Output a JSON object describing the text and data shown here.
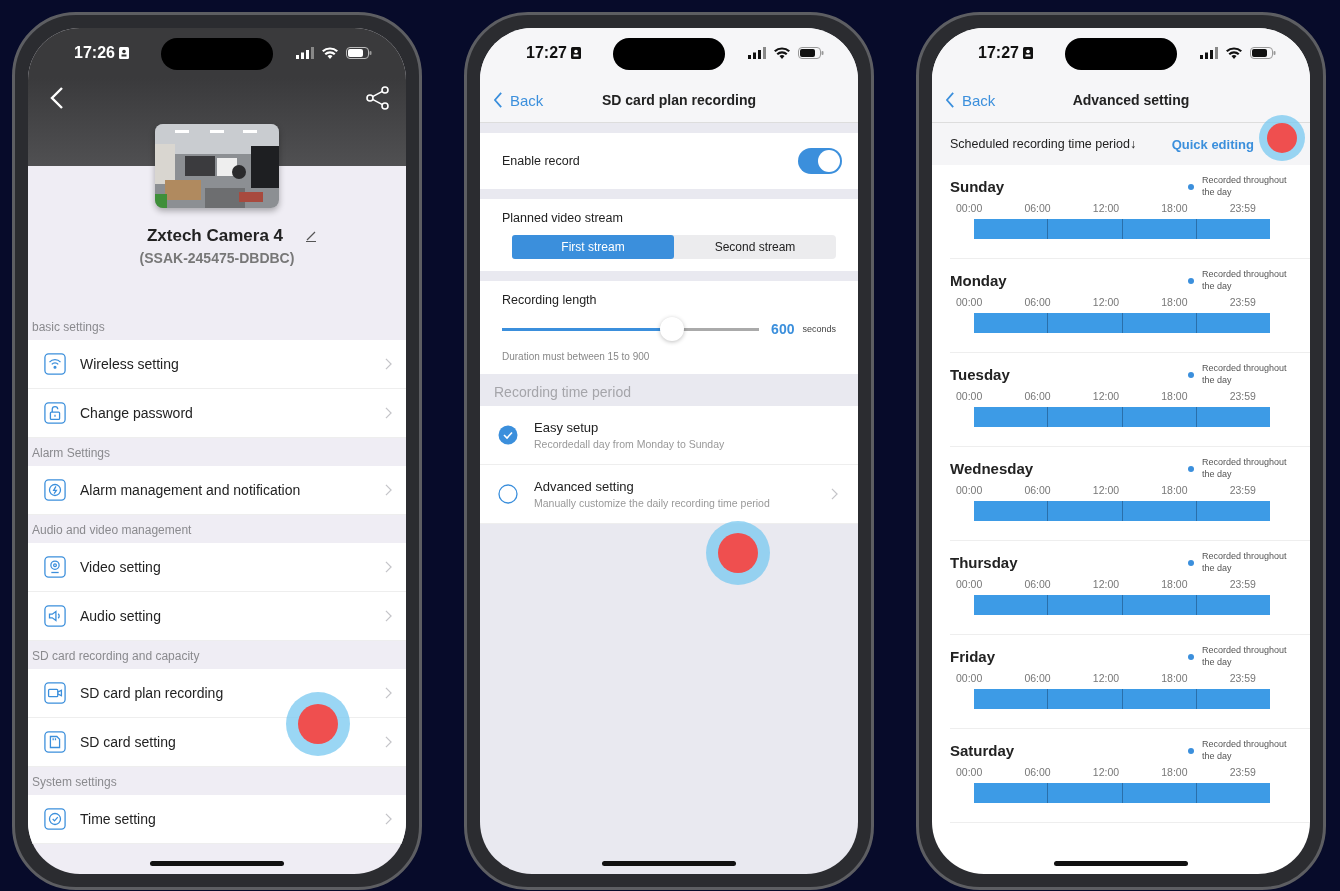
{
  "device_screen": {
    "status_time": "17:26",
    "device_name": "Zxtech Camera 4",
    "device_id": "(SSAK-245475-DBDBC)",
    "sections": [
      {
        "title": "basic settings",
        "items": [
          {
            "label": "Wireless setting",
            "kind": "wifi"
          },
          {
            "label": "Change password",
            "kind": "lock"
          }
        ]
      },
      {
        "title": "Alarm Settings",
        "items": [
          {
            "label": "Alarm management and notification",
            "kind": "alarm"
          }
        ]
      },
      {
        "title": "Audio and video management",
        "items": [
          {
            "label": "Video setting",
            "kind": "webcam"
          },
          {
            "label": "Audio setting",
            "kind": "speaker"
          }
        ]
      },
      {
        "title": "SD card recording and capacity",
        "items": [
          {
            "label": "SD card plan recording",
            "kind": "video"
          },
          {
            "label": "SD card setting",
            "kind": "sdcard"
          }
        ]
      },
      {
        "title": "System settings",
        "items": [
          {
            "label": "Time setting",
            "kind": "clock"
          }
        ]
      }
    ]
  },
  "plan_screen": {
    "status_time": "17:27",
    "back": "Back",
    "title": "SD card plan recording",
    "enable": {
      "label": "Enable record",
      "on": true
    },
    "stream": {
      "label": "Planned video stream",
      "options": [
        {
          "label": "First stream",
          "selected": true
        },
        {
          "label": "Second stream",
          "selected": false
        }
      ]
    },
    "length": {
      "label": "Recording length",
      "level": 0.66,
      "value": "600",
      "unit": "seconds",
      "hint": "Duration must between 15 to 900"
    },
    "period": {
      "title": "Recording time period",
      "options": [
        {
          "label": "Easy setup",
          "description": "Recordedall day from Monday to Sunday",
          "selected": true,
          "has_detail": false
        },
        {
          "label": "Advanced setting",
          "description": "Manually customize the daily recording time period",
          "selected": false,
          "has_detail": true
        }
      ]
    }
  },
  "advanced_screen": {
    "status_time": "17:27",
    "back": "Back",
    "title": "Advanced setting",
    "header": "Scheduled recording time period↓",
    "action": "Quick editing",
    "days": [
      {
        "name": "Sunday",
        "legend": "Recorded throughout the day",
        "ticks": [
          "00:00",
          "06:00",
          "12:00",
          "18:00",
          "23:59"
        ]
      },
      {
        "name": "Monday",
        "legend": "Recorded throughout the day",
        "ticks": [
          "00:00",
          "06:00",
          "12:00",
          "18:00",
          "23:59"
        ]
      },
      {
        "name": "Tuesday",
        "legend": "Recorded throughout the day",
        "ticks": [
          "00:00",
          "06:00",
          "12:00",
          "18:00",
          "23:59"
        ]
      },
      {
        "name": "Wednesday",
        "legend": "Recorded throughout the day",
        "ticks": [
          "00:00",
          "06:00",
          "12:00",
          "18:00",
          "23:59"
        ]
      },
      {
        "name": "Thursday",
        "legend": "Recorded throughout the day",
        "ticks": [
          "00:00",
          "06:00",
          "12:00",
          "18:00",
          "23:59"
        ]
      },
      {
        "name": "Friday",
        "legend": "Recorded throughout the day",
        "ticks": [
          "00:00",
          "06:00",
          "12:00",
          "18:00",
          "23:59"
        ]
      },
      {
        "name": "Saturday",
        "legend": "Recorded throughout the day",
        "ticks": [
          "00:00",
          "06:00",
          "12:00",
          "18:00",
          "23:59"
        ]
      }
    ]
  }
}
